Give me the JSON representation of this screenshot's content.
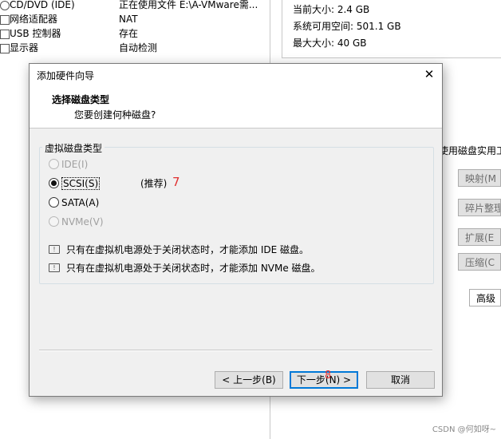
{
  "background": {
    "devices": [
      {
        "name": "CD/DVD (IDE)",
        "value": "正在使用文件 E:\\A-VMware需..."
      },
      {
        "name": "网络适配器",
        "value": "NAT"
      },
      {
        "name": "USB 控制器",
        "value": "存在"
      },
      {
        "name": "显示器",
        "value": "自动检测"
      }
    ],
    "disk_info": [
      {
        "label": "当前大小: 2.4 GB"
      },
      {
        "label": "系统可用空间: 501.1 GB"
      },
      {
        "label": "最大大小: 40 GB"
      }
    ],
    "utilities_label": "使用磁盘实用工",
    "buttons": {
      "map": "映射(M",
      "defrag": "碎片整理",
      "expand": "扩展(E",
      "compact": "压缩(C",
      "advanced": "高级"
    }
  },
  "dialog": {
    "title": "添加硬件向导",
    "close_glyph": "✕",
    "header_title": "选择磁盘类型",
    "header_subtitle": "您要创建何种磁盘?",
    "group_label": "虚拟磁盘类型",
    "options": [
      {
        "label": "IDE(I)",
        "disabled": true,
        "selected": false
      },
      {
        "label": "SCSI(S)",
        "disabled": false,
        "selected": true
      },
      {
        "label": "SATA(A)",
        "disabled": false,
        "selected": false
      },
      {
        "label": "NVMe(V)",
        "disabled": true,
        "selected": false
      }
    ],
    "recommended": "(推荐)",
    "annotation_7": "7",
    "annotation_8": "8",
    "notes": [
      "只有在虚拟机电源处于关闭状态时，才能添加 IDE 磁盘。",
      "只有在虚拟机电源处于关闭状态时，才能添加 NVMe 磁盘。"
    ],
    "buttons": {
      "back": "< 上一步(B)",
      "next": "下一步(N) >",
      "cancel": "取消"
    }
  },
  "watermark": "CSDN @何如呀~"
}
